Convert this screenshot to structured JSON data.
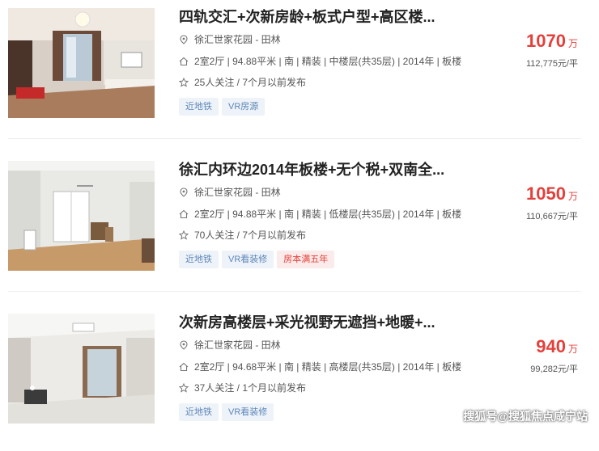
{
  "listings": [
    {
      "title": "四轨交汇+次新房龄+板式户型+高区楼...",
      "community": "徐汇世家花园 - 田林",
      "details": "2室2厅 | 94.88平米 | 南 | 精装 | 中楼层(共35层) | 2014年 | 板楼",
      "followers": "25人关注 / 7个月以前发布",
      "tags": [
        "近地铁",
        "VR房源"
      ],
      "price": "1070",
      "price_unit": "万",
      "unit_price": "112,775元/平"
    },
    {
      "title": "徐汇内环边2014年板楼+无个税+双南全...",
      "community": "徐汇世家花园 - 田林",
      "details": "2室2厅 | 94.88平米 | 南 | 精装 | 低楼层(共35层) | 2014年 | 板楼",
      "followers": "70人关注 / 7个月以前发布",
      "tags": [
        "近地铁",
        "VR看装修",
        "房本满五年"
      ],
      "price": "1050",
      "price_unit": "万",
      "unit_price": "110,667元/平"
    },
    {
      "title": "次新房高楼层+采光视野无遮挡+地暖+...",
      "community": "徐汇世家花园 - 田林",
      "details": "2室2厅 | 94.68平米 | 南 | 精装 | 高楼层(共35层) | 2014年 | 板楼",
      "followers": "37人关注 / 1个月以前发布",
      "tags": [
        "近地铁",
        "VR看装修"
      ],
      "price": "940",
      "price_unit": "万",
      "unit_price": "99,282元/平"
    }
  ],
  "colors": {
    "accent_red": "#e4403b",
    "tag_blue_text": "#5c86b8",
    "tag_blue_bg": "#eef3f9"
  },
  "icons": [
    "location-pin-icon",
    "house-icon",
    "star-icon"
  ],
  "watermark": "搜狐号@搜狐焦点咸宁站"
}
